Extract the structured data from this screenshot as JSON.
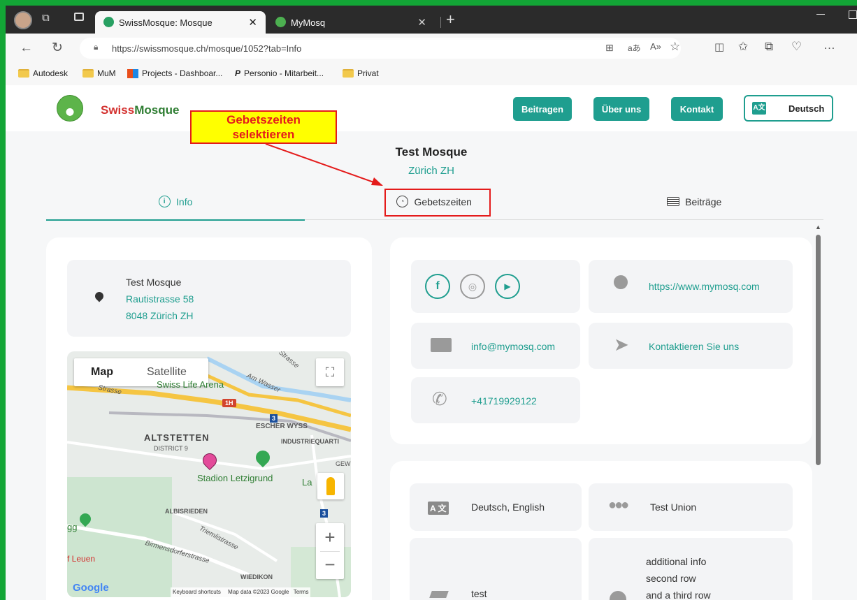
{
  "browser": {
    "tabs": [
      {
        "title": "SwissMosque: Mosque",
        "active": true
      },
      {
        "title": "MyMosq",
        "active": false
      }
    ],
    "url": "https://swissmosque.ch/mosque/1052?tab=Info",
    "bookmarks": [
      "Autodesk",
      "MuM",
      "Projects - Dashboar...",
      "Personio - Mitarbeit...",
      "Privat"
    ]
  },
  "site": {
    "brand_swiss": "Swiss",
    "brand_mosque": "Mosque",
    "nav": {
      "contribute": "Beitragen",
      "about": "Über uns",
      "contact": "Kontakt",
      "language": "Deutsch"
    }
  },
  "annotation": {
    "line1": "Gebetszeiten",
    "line2": "selektieren"
  },
  "mosque": {
    "name": "Test Mosque",
    "location": "Zürich ZH"
  },
  "tabs": {
    "info": "Info",
    "prayer_times": "Gebetszeiten",
    "posts": "Beiträge"
  },
  "address": {
    "name": "Test Mosque",
    "street": "Rautistrasse 58",
    "city": "8048 Zürich ZH"
  },
  "map": {
    "type_map": "Map",
    "type_satellite": "Satellite",
    "labels": {
      "arena": "Swiss Life Arena",
      "altstetten": "ALTSTETTEN",
      "district": "DISTRICT 9",
      "escher": "ESCHER WYSS",
      "industrie": "INDUSTRIEQUARTI",
      "stadion": "Stadion Letzigrund",
      "albisrieden": "ALBISRIEDEN",
      "wiedikon": "WIEDIKON",
      "leuen": "f Leuen",
      "birmens": "Birmensdorferstrasse",
      "road_1h": "1H",
      "road_3a": "3",
      "road_3b": "3",
      "road_gew": "GEW",
      "road_la": "La",
      "road_tr": "Triemlistrasse",
      "road_gg": "gg",
      "street_a": "Am Wasser",
      "street_b": "Strasse",
      "street_c": "Strasse"
    },
    "google": "Google",
    "keyboard": "Keyboard shortcuts",
    "mapdata": "Map data ©2023 Google",
    "terms": "Terms"
  },
  "contact": {
    "website": "https://www.mymosq.com",
    "email": "info@mymosq.com",
    "contact_us": "Kontaktieren Sie uns",
    "phone": "+41719929122"
  },
  "details": {
    "languages": "Deutsch, English",
    "union": "Test Union",
    "education": "test",
    "additional_1": "additional info",
    "additional_2": "second row",
    "additional_3": "and a third row"
  },
  "colors": {
    "accent": "#1f9e8f",
    "brand_red": "#d3312f",
    "brand_green": "#2e7d32",
    "annotation_red": "#e41b1b",
    "annotation_bg": "#ffff00"
  },
  "icons": [
    "location-pin-icon",
    "facebook-icon",
    "instagram-icon",
    "youtube-icon",
    "globe-icon",
    "envelope-icon",
    "paper-plane-icon",
    "phone-icon",
    "language-icon",
    "users-icon",
    "info-icon",
    "clock-icon",
    "newspaper-icon",
    "translate-icon",
    "fullscreen-icon",
    "pegman-icon"
  ]
}
